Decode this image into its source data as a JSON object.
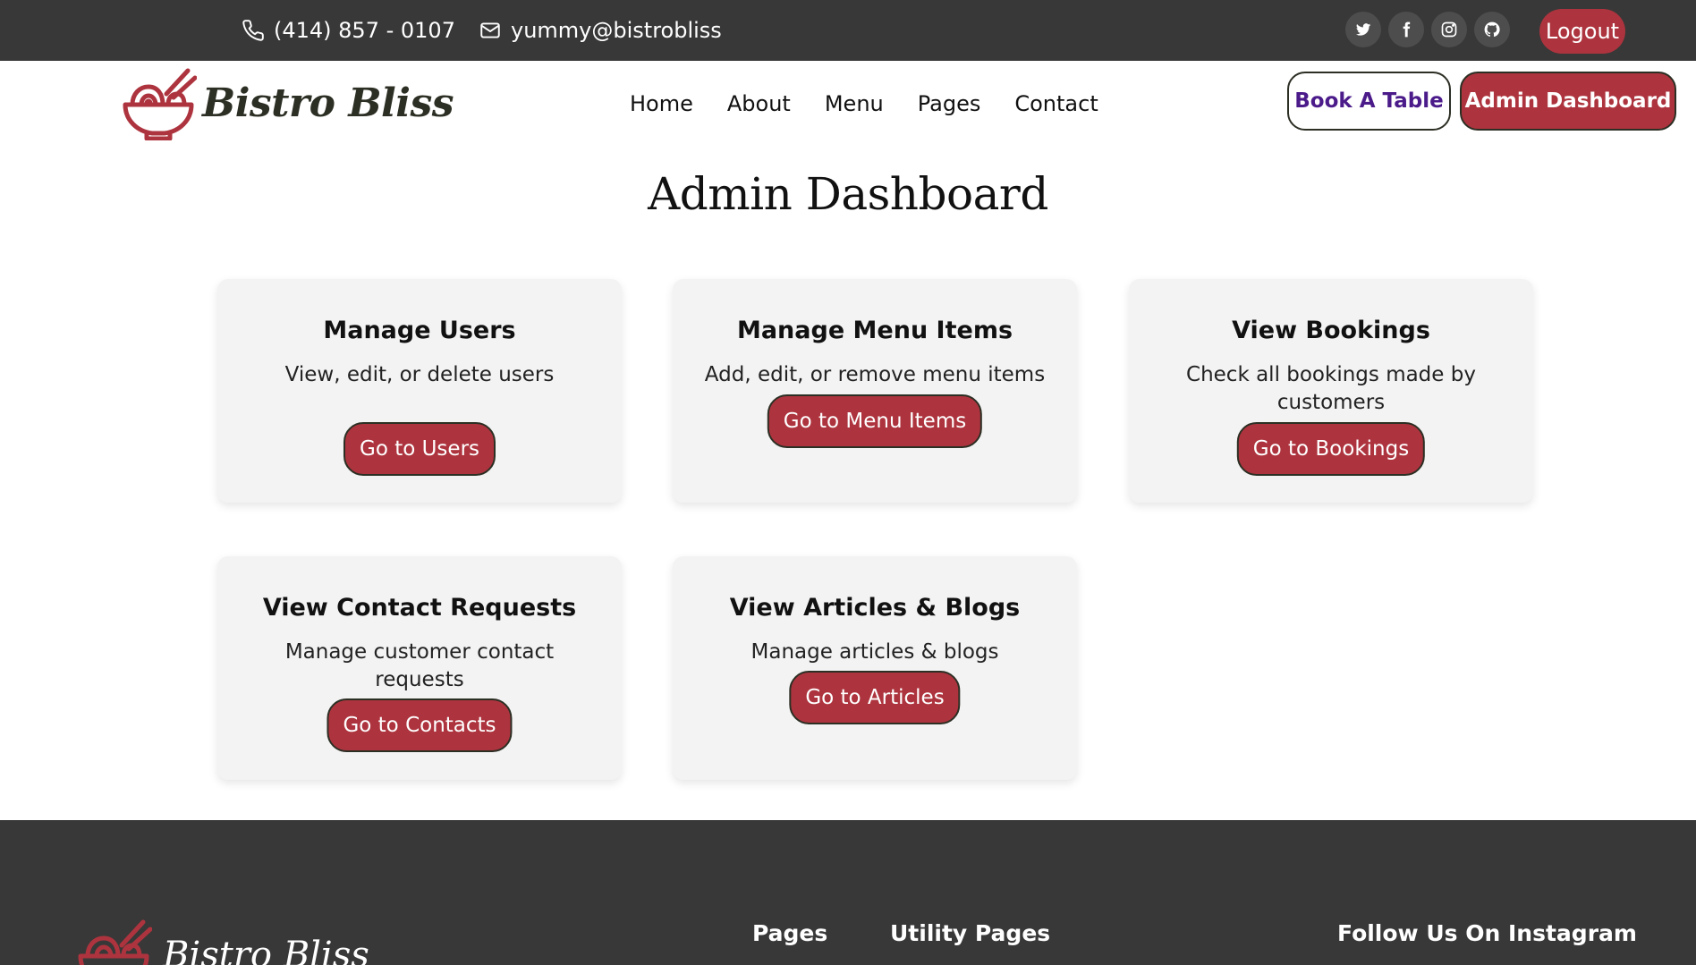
{
  "topbar": {
    "phone": "(414) 857 - 0107",
    "email": "yummy@bistrobliss",
    "socials": [
      "twitter-icon",
      "facebook-icon",
      "instagram-icon",
      "github-icon"
    ],
    "logout_label": "Logout"
  },
  "header": {
    "brand": "Bistro Bliss",
    "nav": [
      "Home",
      "About",
      "Menu",
      "Pages",
      "Contact"
    ],
    "book_label": "Book A Table",
    "admin_label": "Admin Dashboard"
  },
  "main": {
    "title": "Admin Dashboard",
    "cards": [
      {
        "title": "Manage Users",
        "desc": "View, edit, or delete users",
        "button": "Go to Users"
      },
      {
        "title": "Manage Menu Items",
        "desc": "Add, edit, or remove menu items",
        "button": "Go to Menu Items"
      },
      {
        "title": "View Bookings",
        "desc": "Check all bookings made by customers",
        "button": "Go to Bookings"
      },
      {
        "title": "View Contact Requests",
        "desc": "Manage customer contact requests",
        "button": "Go to Contacts"
      },
      {
        "title": "View Articles & Blogs",
        "desc": "Manage articles & blogs",
        "button": "Go to Articles"
      }
    ]
  },
  "footer": {
    "brand": "Bistro Bliss",
    "pages_heading": "Pages",
    "utility_heading": "Utility Pages",
    "instagram_heading": "Follow Us On Instagram"
  },
  "colors": {
    "accent": "#ad343e",
    "dark_bar": "#383838",
    "card_bg": "#f3f3f3",
    "book_text": "#4b1b8a"
  }
}
